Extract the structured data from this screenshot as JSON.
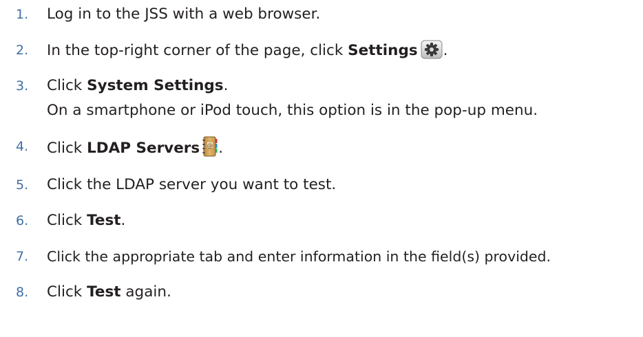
{
  "steps": [
    {
      "number": "1.",
      "before": "Log in to the JSS with a web browser.",
      "bold": "",
      "after": ""
    },
    {
      "number": "2.",
      "before": "In the top-right corner of the page, click ",
      "bold": "Settings",
      "after": ".",
      "icon": "settings-gear-icon"
    },
    {
      "number": "3.",
      "before": "Click ",
      "bold": "System Settings",
      "after": ".",
      "note": "On a smartphone or iPod touch, this option is in the pop-up menu."
    },
    {
      "number": "4.",
      "before": "Click ",
      "bold": "LDAP Servers",
      "after": ".",
      "icon": "address-book-icon"
    },
    {
      "number": "5.",
      "before": "Click the LDAP server you want to test.",
      "bold": "",
      "after": ""
    },
    {
      "number": "6.",
      "before": "Click ",
      "bold": "Test",
      "after": "."
    },
    {
      "number": "7.",
      "before": "Click the appropriate tab and enter information in the field(s) provided.",
      "bold": "",
      "after": ""
    },
    {
      "number": "8.",
      "before": "Click ",
      "bold": "Test",
      "after": " again."
    }
  ],
  "colors": {
    "number": "#3f6fa6",
    "text": "#231f20"
  }
}
